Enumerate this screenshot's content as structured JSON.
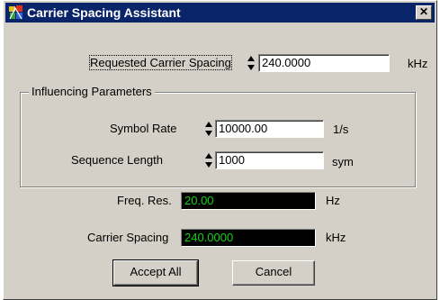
{
  "window": {
    "title": "Carrier Spacing Assistant",
    "close_glyph": "✕",
    "icon": "app-icon"
  },
  "requested": {
    "label": "Requested Carrier Spacing",
    "value": "240.0000",
    "unit": "kHz"
  },
  "influencing": {
    "group_title": "Influencing Parameters",
    "symbol_rate": {
      "label": "Symbol  Rate",
      "value": "10000.00",
      "unit": "1/s"
    },
    "sequence_length": {
      "label": "Sequence Length",
      "value": "1000",
      "unit": "sym"
    }
  },
  "freq_res": {
    "label": "Freq. Res.",
    "value": "20.00",
    "unit": "Hz"
  },
  "carrier_spacing": {
    "label": "Carrier Spacing",
    "value": "240.0000",
    "unit": "kHz"
  },
  "buttons": {
    "accept_all": "Accept All",
    "cancel": "Cancel"
  },
  "colors": {
    "titlebar": "#0a246a",
    "readout_bg": "#000000",
    "readout_fg": "#18d018",
    "face": "#d4d0c8"
  }
}
